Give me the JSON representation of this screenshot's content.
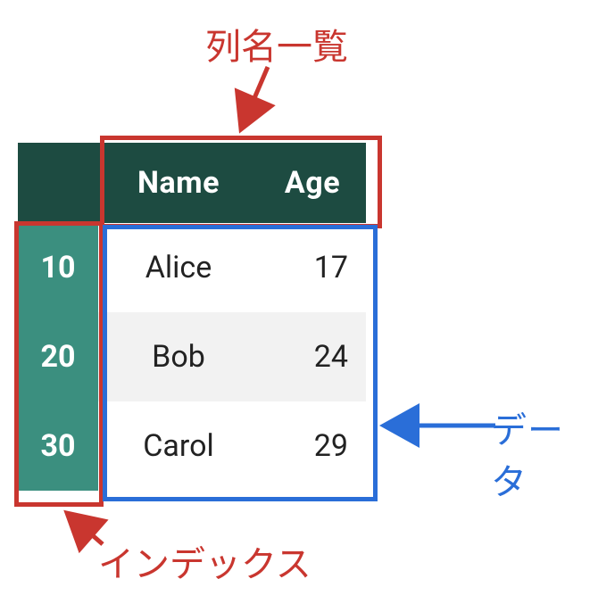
{
  "chart_data": {
    "type": "table",
    "columns": [
      "Name",
      "Age"
    ],
    "index": [
      10,
      20,
      30
    ],
    "rows": [
      {
        "Name": "Alice",
        "Age": 17
      },
      {
        "Name": "Bob",
        "Age": 24
      },
      {
        "Name": "Carol",
        "Age": 29
      }
    ]
  },
  "labels": {
    "columns": "列名一覧",
    "index": "インデックス",
    "data": "データ"
  },
  "colors": {
    "header_bg": "#1d4b41",
    "index_bg": "#3b8f7f",
    "highlight_red": "#c9362f",
    "highlight_blue": "#2a6ed8"
  }
}
